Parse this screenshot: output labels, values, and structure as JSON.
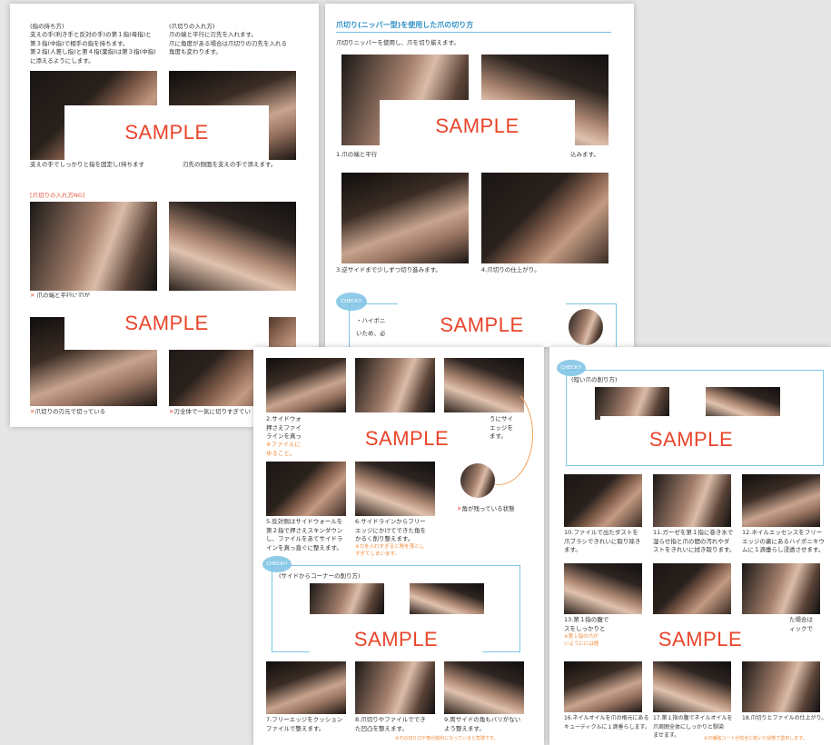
{
  "sample_label": "SAMPLE",
  "page1": {
    "holding_title": "(指の持ち方)",
    "holding_body": "支えの手(利き手と反対の手)の第１指(母指)と\n第３指(中指)で相手の指を持ちます。\n第２指(人差し指)と第４指(薬指)は第３指(中指)\nに添えるようにします。",
    "insert_title": "(爪切りの入れ方)",
    "insert_body": "爪の端と平行に刃先を入れます。\n爪に角度がある場合は爪切りの刃先を入れる\n角度も変わります。",
    "caption_support": "支えの手でしっかりと指を固定し(持ちます",
    "caption_insert": "刃先の側面を支えの手で添えます。",
    "ng_title": "[爪切りの入れ方NG]",
    "ng_caption1": "✕ 爪の端と平行に刃が",
    "ng_caption2": "✕ 刃先だけで爪を切っている",
    "ng_caption3": "✕ 刃全体で一気に切りすぎている"
  },
  "page2": {
    "heading": "爪切り(ニッパー型)を使用した爪の切り方",
    "intro": "爪切りニッパーを使用し、爪を切り揃えます。",
    "caption1": "1.爪の端と平行",
    "caption1b": "込みます。",
    "caption3": "3.逆サイドまで少しずつ切り進みます。",
    "caption4": "4.爪切りの仕上がり。",
    "check_label": "CHECK!!",
    "check_line1": "・ハイポニ",
    "check_line2": "いため、必"
  },
  "page3": {
    "caption2": "2.サイドウォ\n押さえファイ\nラインを真っ",
    "caption2_note": "※ファイルに\nゆること。",
    "caption3": "うにサイ\nエッジを\nます。",
    "ng_label": "✕ 角が残っている状態",
    "caption5": "5.反対側はサイドウォールを\n第２指で押さえスキンダウン\nし、ファイルをあてサイドラ\nインを真っ直ぐに整えます。",
    "caption6": "6.サイドラインからフリー\nエッジにかけてできた角を\nかるく削り整えます。",
    "caption6_note": "※力を入れすぎると角を落とし\nすぎてしまいます。",
    "check_label": "CHECK!!",
    "corner_title": "(サイドからコーナーの削り方)",
    "caption7": "7.フリーエッジをクッション\nファイルで整えます。",
    "caption8": "8.爪切りやファイルででき\nた凹凸を整えます。",
    "caption9": "9.両サイドの角もバリがない\nよう整えます。",
    "footer_note": "※爪の切り口や角が鋭利になっていると危険です。"
  },
  "page4": {
    "check_label": "CHECK!!",
    "short_title": "(短い爪の削り方)",
    "caption10": "10.ファイルで出たダストを\n爪ブラシできれいに取り除き\nます。",
    "caption11": "11.ガーゼを第１指に巻き水で\n湿らせ指と爪の間の汚れやダ\nストをきれいに拭き取ります。",
    "caption12": "12.ネイルエッセンスをフリー\nエッジの裏にあるハイポニキウ\nムに１滴垂らし浸透させます。",
    "caption13": "13.第１指の腹で\nスをしっかりと",
    "caption13_note": "※第１指の爪が\nいようにには極",
    "caption15": "た場合は\nィックで",
    "caption16": "16.ネイルオイルを爪の根元にある\nキューティクルに１滴垂らします。",
    "caption17": "17.第１指の腹でネイルオイルを\n爪周囲全体にしっかりと馴染\nませます。",
    "caption18": "18.爪切りとファイルの仕上がり。",
    "footer_note": "※爪補強コートが完全に乾いた状態で塗布します。"
  }
}
